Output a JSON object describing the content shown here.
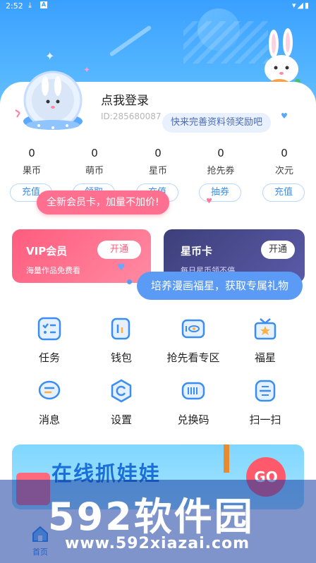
{
  "status_bar": {
    "time": "2:52",
    "download_icon": "download-icon",
    "notification_icon": "A",
    "right_icons": "wifi-icon signal-icon battery-icon"
  },
  "profile": {
    "login_label": "点我登录",
    "uid": "ID:285680087",
    "info_tip": "快来完善资料领奖励吧"
  },
  "stats": [
    {
      "value": "0",
      "label": "果币"
    },
    {
      "value": "0",
      "label": "萌币"
    },
    {
      "value": "0",
      "label": "星币"
    },
    {
      "value": "0",
      "label": "抢先券"
    },
    {
      "value": "0",
      "label": "次元"
    }
  ],
  "pills": [
    {
      "label": "充值"
    },
    {
      "label": "领取"
    },
    {
      "label": "充值"
    },
    {
      "label": "抽券"
    },
    {
      "label": "充值"
    }
  ],
  "promo_tip": "全新会员卡，加量不加价!",
  "vip_card": {
    "title": "VIP会员",
    "subtitle": "海量作品免费看",
    "button": "开通"
  },
  "star_card": {
    "title": "星币卡",
    "subtitle": "每日星币领不停",
    "button": "开通"
  },
  "nurture_tip": "培养漫画福星，获取专属礼物",
  "grid": [
    {
      "label": "任务",
      "icon": "task-icon"
    },
    {
      "label": "钱包",
      "icon": "wallet-icon"
    },
    {
      "label": "抢先看专区",
      "icon": "preview-icon"
    },
    {
      "label": "福星",
      "icon": "lucky-star-icon"
    },
    {
      "label": "消息",
      "icon": "message-icon"
    },
    {
      "label": "设置",
      "icon": "settings-icon"
    },
    {
      "label": "兑换码",
      "icon": "redeem-code-icon"
    },
    {
      "label": "扫一扫",
      "icon": "scan-icon"
    }
  ],
  "banner": {
    "title": "在线抓娃娃",
    "go_label": "GO"
  },
  "watermark": {
    "brand": "592软件园",
    "url": "www.592xiazai.com"
  },
  "tabbar": {
    "home_label": "首页"
  },
  "colors": {
    "primary": "#3aa0ff",
    "vip": "#ff5c7e",
    "star_card": "#3d3f7a",
    "tip": "#5b9bf5"
  }
}
